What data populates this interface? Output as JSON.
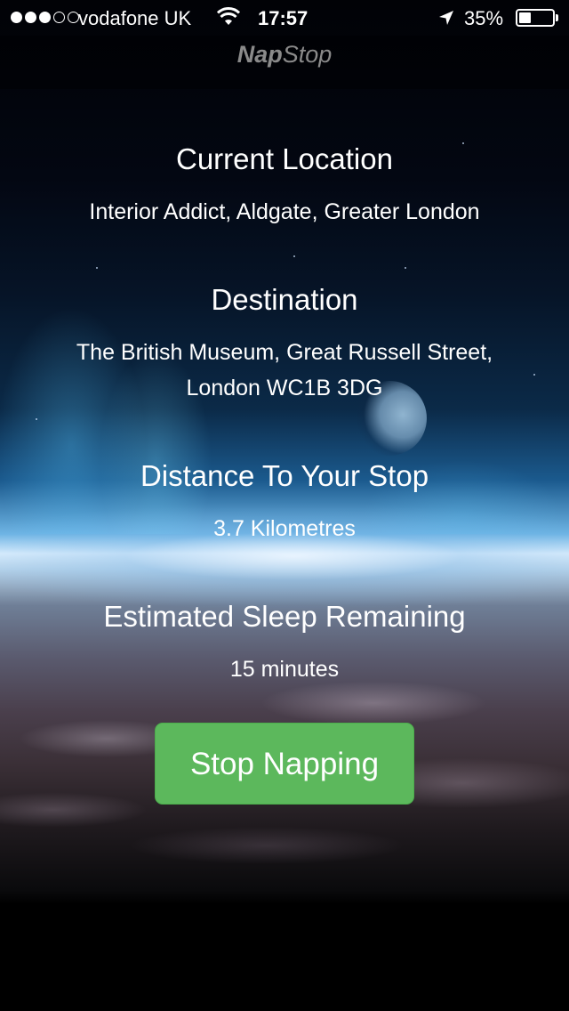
{
  "status_bar": {
    "carrier": "vodafone UK",
    "time": "17:57",
    "battery_percent": "35%",
    "battery_level": 0.35,
    "signal_bars_filled": 3,
    "signal_bars_total": 5
  },
  "nav": {
    "title_bold": "Nap",
    "title_rest": "Stop"
  },
  "current_location": {
    "heading": "Current Location",
    "value": "Interior Addict, Aldgate, Greater London"
  },
  "destination": {
    "heading": "Destination",
    "line1": "The British Museum, Great Russell Street,",
    "line2": "London WC1B 3DG"
  },
  "distance": {
    "heading": "Distance To Your Stop",
    "value": "3.7 Kilometres"
  },
  "sleep": {
    "heading": "Estimated Sleep Remaining",
    "value": "15 minutes"
  },
  "actions": {
    "stop_label": "Stop Napping"
  },
  "colors": {
    "button": "#5cb85c",
    "nav_title": "#8a8a8a"
  }
}
